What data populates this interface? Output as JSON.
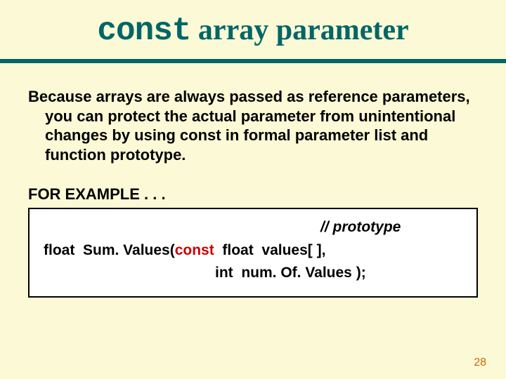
{
  "title": {
    "keyword": "const",
    "rest": " array parameter"
  },
  "body": {
    "paragraph": "Because arrays are always passed as reference parameters, you can protect the actual parameter from unintentional changes by using const in formal parameter list and function prototype."
  },
  "example": {
    "label": "FOR EXAMPLE . . .",
    "comment": "// prototype",
    "line1_a": "float  Sum. Values(",
    "const_kw": "const",
    "line1_b": "  float  values[ ],",
    "line2": "int  num. Of. Values );"
  },
  "page_number": "28"
}
